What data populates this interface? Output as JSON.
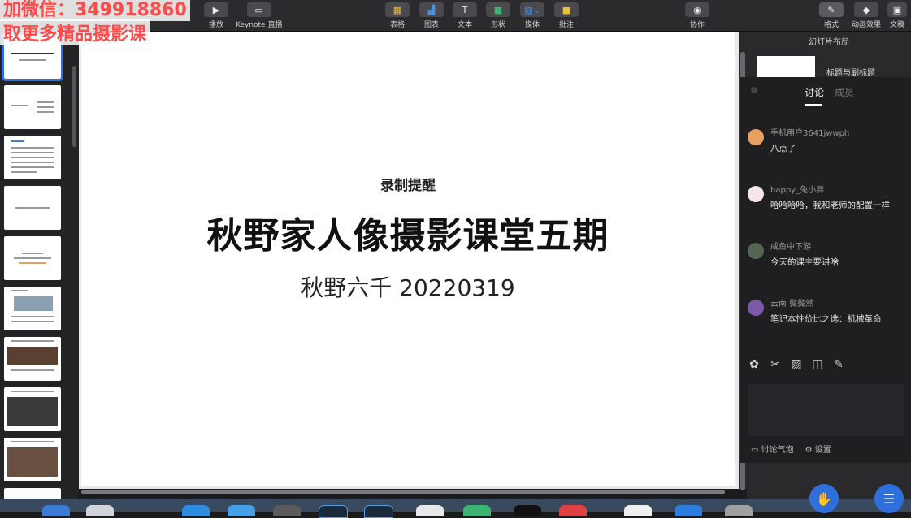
{
  "watermark": {
    "line1": "加微信：349918860",
    "line2": "取更多精品摄影课"
  },
  "toolbar": {
    "play": "播放",
    "keynote_live": "Keynote 直播",
    "table": "表格",
    "chart": "图表",
    "text": "文本",
    "shape": "形状",
    "media": "媒体",
    "comment": "批注",
    "collaborate": "协作",
    "format": "格式",
    "animate": "动画效果",
    "document": "文稿"
  },
  "slide": {
    "small_title": "录制提醒",
    "title": "秋野家人像摄影课堂五期",
    "subtitle": "秋野六千 20220319"
  },
  "inspector": {
    "title": "幻灯片布局",
    "layout_label": "标题与副标题"
  },
  "chat": {
    "tabs": [
      {
        "label": "讨论"
      },
      {
        "label": "成员"
      }
    ],
    "messages": [
      {
        "user": "手机用户3641jwwph",
        "text": "八点了",
        "avatar_color": "#e8a060"
      },
      {
        "user": "happy_兔小异",
        "text": "哈哈哈哈，我和老师的配置一样",
        "avatar_color": "#f4e6e6"
      },
      {
        "user": "咸鱼中下游",
        "text": "今天的课主要讲啥",
        "avatar_color": "#556655"
      },
      {
        "user": "云南 鬓鬓然",
        "text": "笔记本性价比之选：机械革命",
        "avatar_color": "#7a5aa8"
      }
    ],
    "bubble": "讨论气泡",
    "settings": "设置"
  }
}
